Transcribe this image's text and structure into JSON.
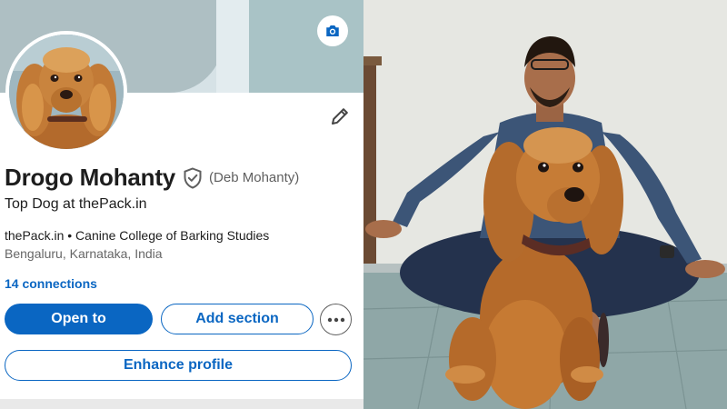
{
  "profile": {
    "name": "Drogo Mohanty",
    "alt_name": "(Deb Mohanty)",
    "headline": "Top Dog at thePack.in",
    "org_line": "thePack.in • Canine College of Barking Studies",
    "location": "Bengaluru, Karnataka, India",
    "connections": "14 connections"
  },
  "actions": {
    "open_to": "Open to",
    "add_section": "Add section",
    "enhance_profile": "Enhance profile"
  },
  "icons": {
    "camera": "camera-icon",
    "edit": "pencil-icon",
    "verified": "verified-shield-icon",
    "more": "more-horizontal-icon"
  },
  "colors": {
    "accent": "#0a66c2",
    "text": "#1d1d1d",
    "muted": "#666666"
  }
}
